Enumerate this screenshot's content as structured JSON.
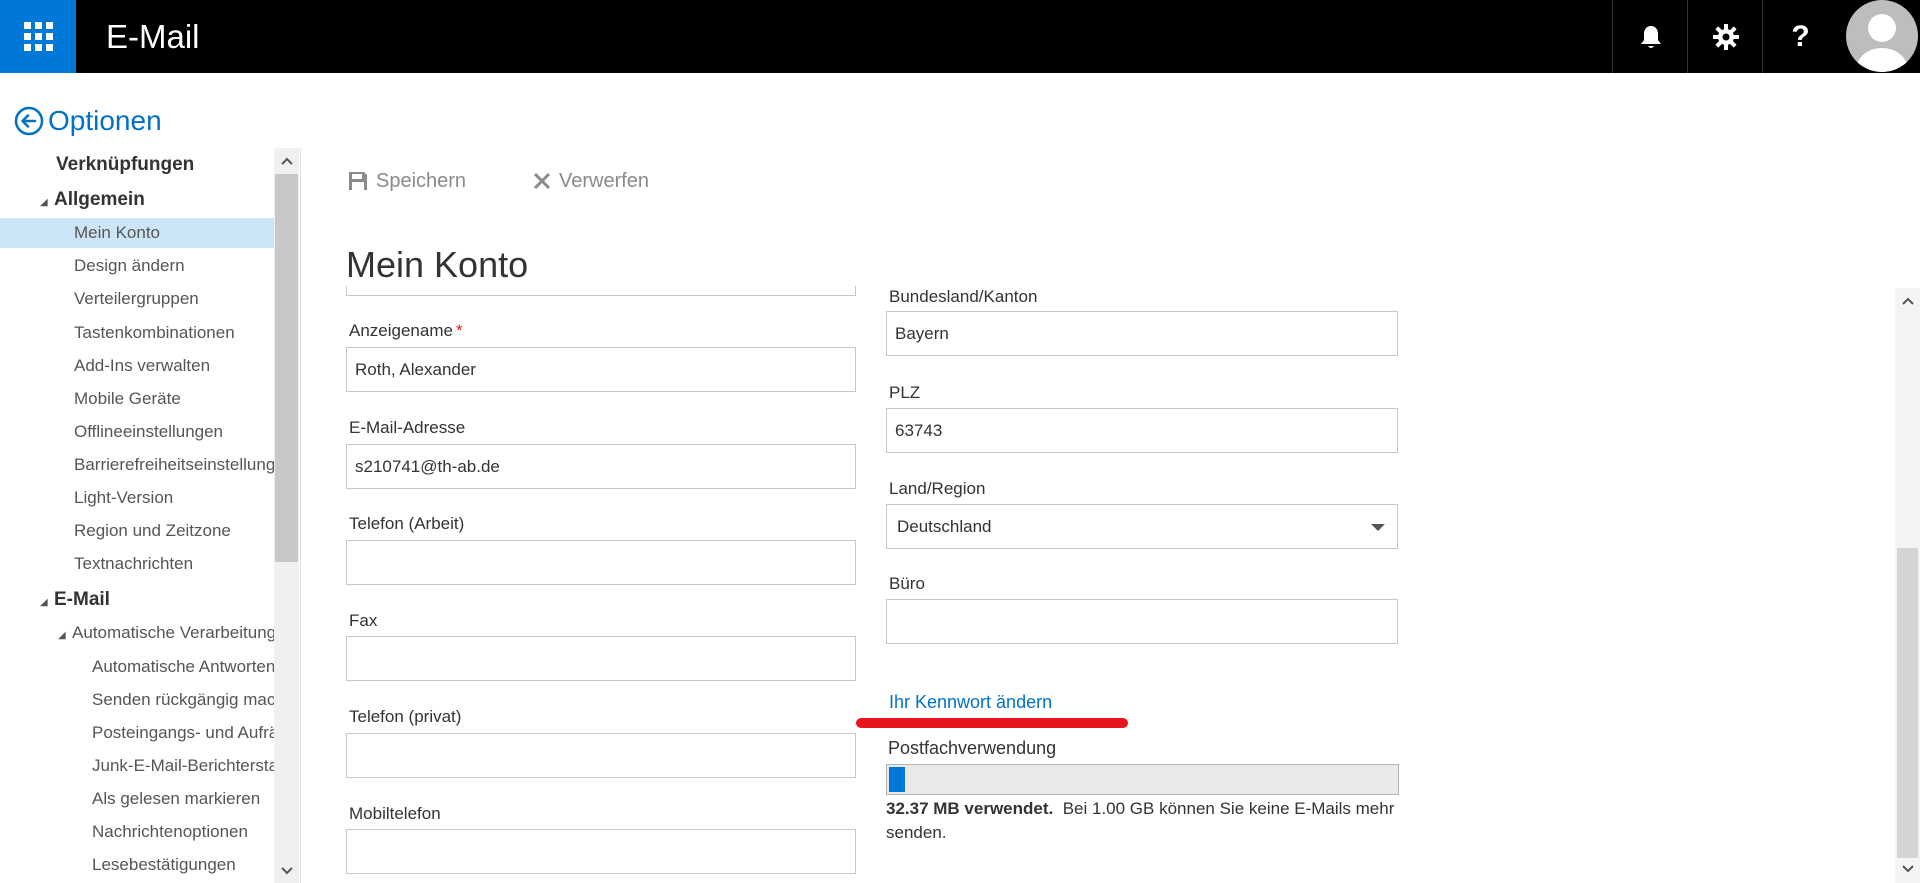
{
  "topbar": {
    "app_title": "E-Mail",
    "waffle_icon": "app-launcher-icon",
    "bell_icon": "bell-icon",
    "gear_icon": "gear-icon",
    "help_label": "?",
    "avatar_icon": "avatar-icon",
    "brand_color": "#0078d7"
  },
  "options": {
    "label": "Optionen",
    "icon": "back-arrow-circle-icon"
  },
  "nav": {
    "items": [
      {
        "label": "Verknüpfungen"
      },
      {
        "label": "Allgemein"
      },
      {
        "label": "Mein Konto"
      },
      {
        "label": "Design ändern"
      },
      {
        "label": "Verteilergruppen"
      },
      {
        "label": "Tastenkombinationen"
      },
      {
        "label": "Add-Ins verwalten"
      },
      {
        "label": "Mobile Geräte"
      },
      {
        "label": "Offlineeinstellungen"
      },
      {
        "label": "Barrierefreiheitseinstellungen"
      },
      {
        "label": "Light-Version"
      },
      {
        "label": "Region und Zeitzone"
      },
      {
        "label": "Textnachrichten"
      },
      {
        "label": "E-Mail"
      },
      {
        "label": "Automatische Verarbeitung"
      },
      {
        "label": "Automatische Antworten"
      },
      {
        "label": "Senden rückgängig machen"
      },
      {
        "label": "Posteingangs- und Aufräumregeln"
      },
      {
        "label": "Junk-E-Mail-Berichterstattung"
      },
      {
        "label": "Als gelesen markieren"
      },
      {
        "label": "Nachrichtenoptionen"
      },
      {
        "label": "Lesebestätigungen"
      }
    ],
    "selected": "Mein Konto"
  },
  "commands": {
    "save": "Speichern",
    "discard": "Verwerfen"
  },
  "page": {
    "title": "Mein Konto"
  },
  "form": {
    "display_name": {
      "label": "Anzeigename",
      "required_mark": "*",
      "value": "Roth, Alexander"
    },
    "email": {
      "label": "E-Mail-Adresse",
      "value": "s210741@th-ab.de"
    },
    "phone_work": {
      "label": "Telefon (Arbeit)",
      "value": ""
    },
    "fax": {
      "label": "Fax",
      "value": ""
    },
    "phone_private": {
      "label": "Telefon (privat)",
      "value": ""
    },
    "mobile": {
      "label": "Mobiltelefon",
      "value": ""
    },
    "state": {
      "label": "Bundesland/Kanton",
      "value": "Bayern"
    },
    "zip": {
      "label": "PLZ",
      "value": "63743"
    },
    "country": {
      "label": "Land/Region",
      "value": "Deutschland"
    },
    "office": {
      "label": "Büro",
      "value": ""
    }
  },
  "password_link": "Ihr Kennwort ändern",
  "mailbox": {
    "label": "Postfachverwendung",
    "used_text": "32.37 MB verwendet.",
    "limit_text": "Bei 1.00 GB können Sie keine E-Mails mehr senden.",
    "used_fraction": 0.032
  }
}
